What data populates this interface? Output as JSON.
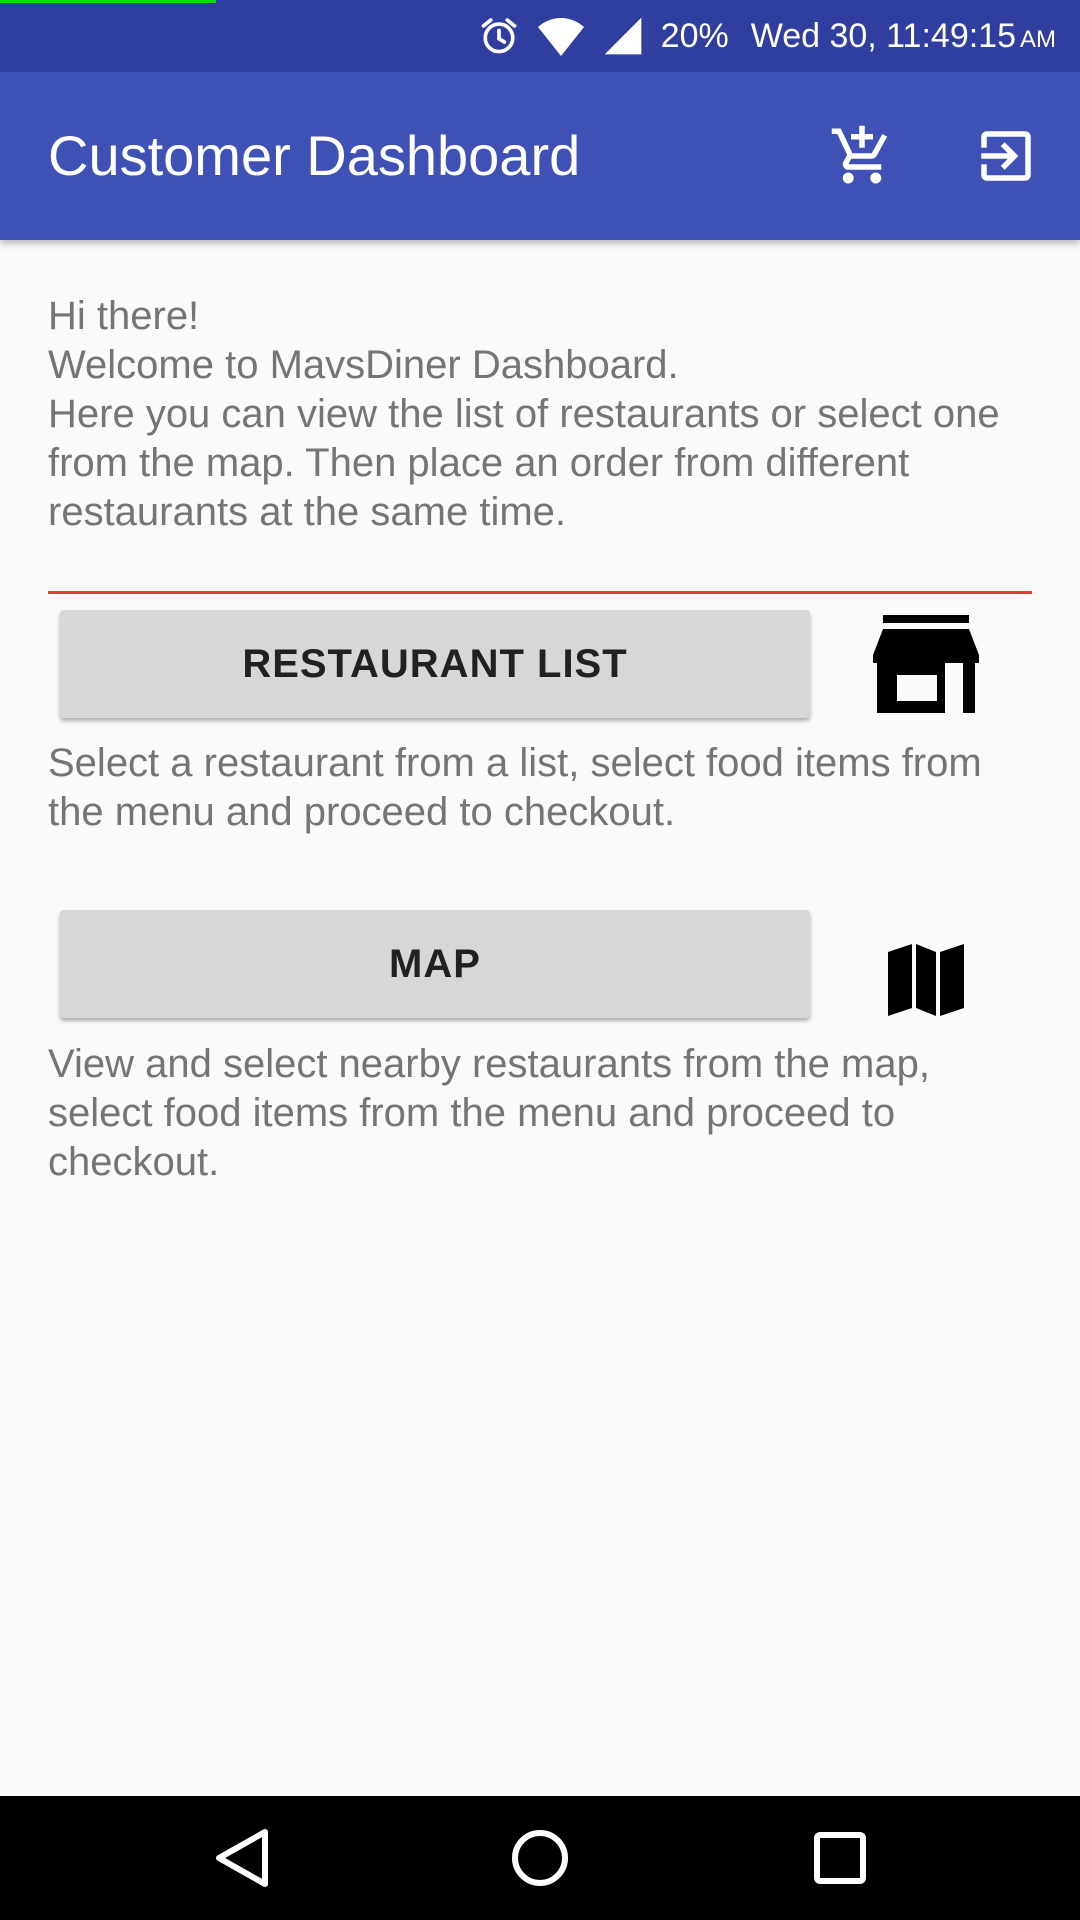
{
  "status_bar": {
    "battery": "20%",
    "time": "Wed 30, 11:49:15",
    "ampm": "AM",
    "icons": [
      "alarm-icon",
      "wifi-icon",
      "cell-signal-icon"
    ]
  },
  "app_bar": {
    "title": "Customer Dashboard",
    "actions": [
      "add-to-cart-icon",
      "exit-icon"
    ]
  },
  "welcome": {
    "text": "Hi there!\n Welcome to MavsDiner Dashboard.\n Here you can view the list of restaurants or select one from the map. Then place an order from different restaurants at the same time."
  },
  "restaurant_list": {
    "button_label": "RESTAURANT LIST",
    "icon": "store-icon",
    "description": "Select a restaurant from a list, select food items from the menu and proceed to checkout."
  },
  "map": {
    "button_label": "MAP",
    "icon": "map-icon",
    "description": "View and select nearby restaurants from the map, select food items from the menu and proceed to checkout."
  },
  "nav_bar": {
    "buttons": [
      "back-icon",
      "home-icon",
      "recents-icon"
    ]
  },
  "colors": {
    "status_bar": "#303f9f",
    "app_bar": "#3f51b5",
    "divider": "#e53935",
    "button": "#d6d7d7",
    "body_text": "#757575"
  }
}
